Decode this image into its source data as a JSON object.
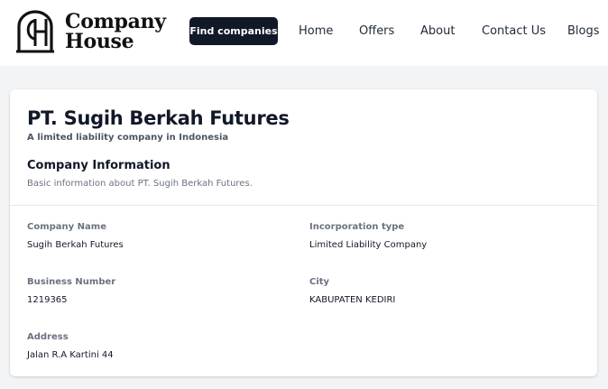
{
  "header": {
    "logo_line1": "Company",
    "logo_line2": "House",
    "logo_icon": "ch-monogram-icon",
    "find_companies_label": "Find companies",
    "nav": [
      {
        "label": "Home"
      },
      {
        "label": "Offers"
      },
      {
        "label": "About"
      },
      {
        "label": "Contact Us"
      },
      {
        "label": "Blogs"
      }
    ]
  },
  "company": {
    "title": "PT. Sugih Berkah Futures",
    "subtitle": "A limited liability company in Indonesia"
  },
  "section": {
    "title": "Company Information",
    "subtitle": "Basic information about PT. Sugih Berkah Futures."
  },
  "fields": [
    {
      "label": "Company Name",
      "value": "Sugih Berkah Futures"
    },
    {
      "label": "Incorporation type",
      "value": "Limited Liability Company"
    },
    {
      "label": "Business Number",
      "value": "1219365"
    },
    {
      "label": "City",
      "value": "KABUPATEN KEDIRI"
    },
    {
      "label": "Address",
      "value": "Jalan R.A Kartini 44"
    }
  ],
  "colors": {
    "accent": "#111827",
    "background": "#f3f4f6",
    "muted_text": "#6b7280"
  }
}
